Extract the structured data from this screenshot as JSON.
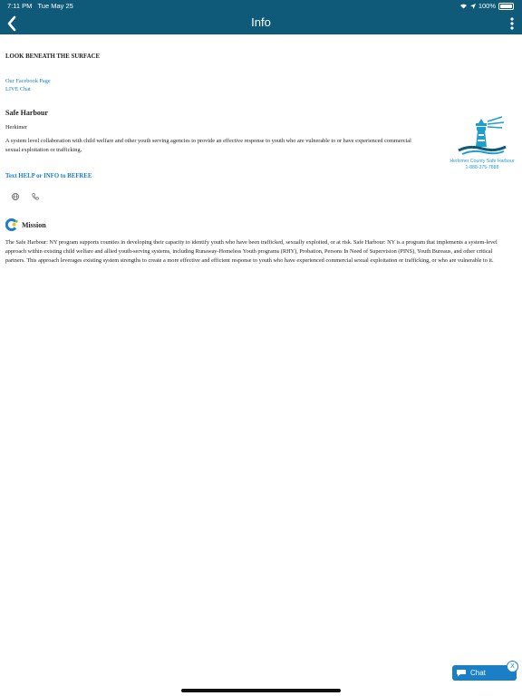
{
  "status_bar": {
    "time": "7:11 PM",
    "date": "Tue May 25",
    "battery": "100%"
  },
  "nav": {
    "title": "Info",
    "back_icon": "chevron-left-icon",
    "menu_icon": "more-vertical-icon"
  },
  "page": {
    "headline": "LOOK BENEATH THE SURFACE",
    "links": {
      "facebook": "Our Facebook Page",
      "live_chat": "LIVE Chat"
    },
    "org": {
      "name": "Safe Harbour",
      "county": "Herkimer",
      "description": "A system level collaboration with child welfare and other youth serving agencies to provide an effective response to youth who are vulnerable to or have experienced commercial sexual exploitation or trafficking."
    },
    "logo": {
      "line1": "Herkimer County Safe Harbour",
      "line2": "1-888-375-7888"
    },
    "text_help": "Text HELP or INFO to BEFREE",
    "contact_icons": [
      "globe-icon",
      "phone-icon"
    ],
    "mission": {
      "title": "Mission",
      "text": "The Safe Harbour: NY program supports counties in developing their capacity to identify youth who have been trafficked, sexually exploited, or at risk. Safe Harbour: NY is a program that implements a system-level approach within existing child welfare and allied youth-serving systems, including Runaway-Homeless Youth programs (RHY), Probation, Persons In Need of Supervision (PINS), Youth Bureaus, and other critical partners. This approach leverages existing system strengths to create a more effective and efficient response to youth who have experienced commercial sexual exploitation or trafficking, or who are vulnerable to it."
    }
  },
  "chat_widget": {
    "label": "Chat",
    "close": "X"
  },
  "colors": {
    "header": "#0e5a78",
    "link": "#1a7fc7"
  }
}
